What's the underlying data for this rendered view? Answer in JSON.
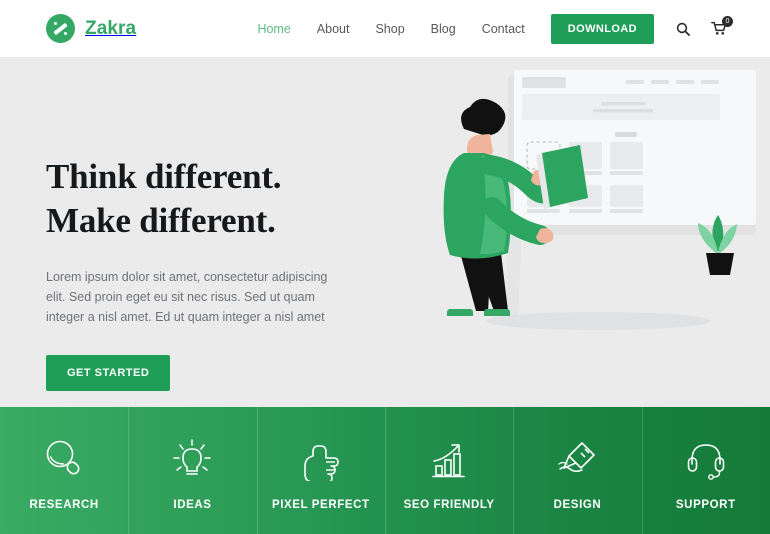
{
  "brand": {
    "name": "Zakra",
    "logo_icon": "zakra-circle-logo",
    "color": "#35a866"
  },
  "nav": {
    "links": [
      {
        "label": "Home",
        "active": true
      },
      {
        "label": "About",
        "active": false
      },
      {
        "label": "Shop",
        "active": false
      },
      {
        "label": "Blog",
        "active": false
      },
      {
        "label": "Contact",
        "active": false
      }
    ],
    "download_label": "DOWNLOAD",
    "search_icon": "search-icon",
    "cart_icon": "cart-icon",
    "cart_count": "0"
  },
  "hero": {
    "title_line1": "Think different.",
    "title_line2": "Make different.",
    "paragraph": "Lorem ipsum dolor sit amet, consectetur adipiscing elit. Sed proin eget eu sit nec risus. Sed ut quam integer a nisl amet.  Ed ut quam integer a nisl amet",
    "cta_label": "GET STARTED",
    "background": "#ebebeb",
    "illustration": "person-placing-card-on-wireframe-board"
  },
  "features": {
    "accent_start": "#3aab63",
    "accent_end": "#147a38",
    "items": [
      {
        "label": "RESEARCH",
        "icon": "magnifier-icon"
      },
      {
        "label": "IDEAS",
        "icon": "lightbulb-icon"
      },
      {
        "label": "PIXEL PERFECT",
        "icon": "thumbs-up-icon"
      },
      {
        "label": "SEO FRIENDLY",
        "icon": "bar-chart-arrow-icon"
      },
      {
        "label": "DESIGN",
        "icon": "marker-pen-icon"
      },
      {
        "label": "SUPPORT",
        "icon": "headset-icon"
      }
    ]
  }
}
